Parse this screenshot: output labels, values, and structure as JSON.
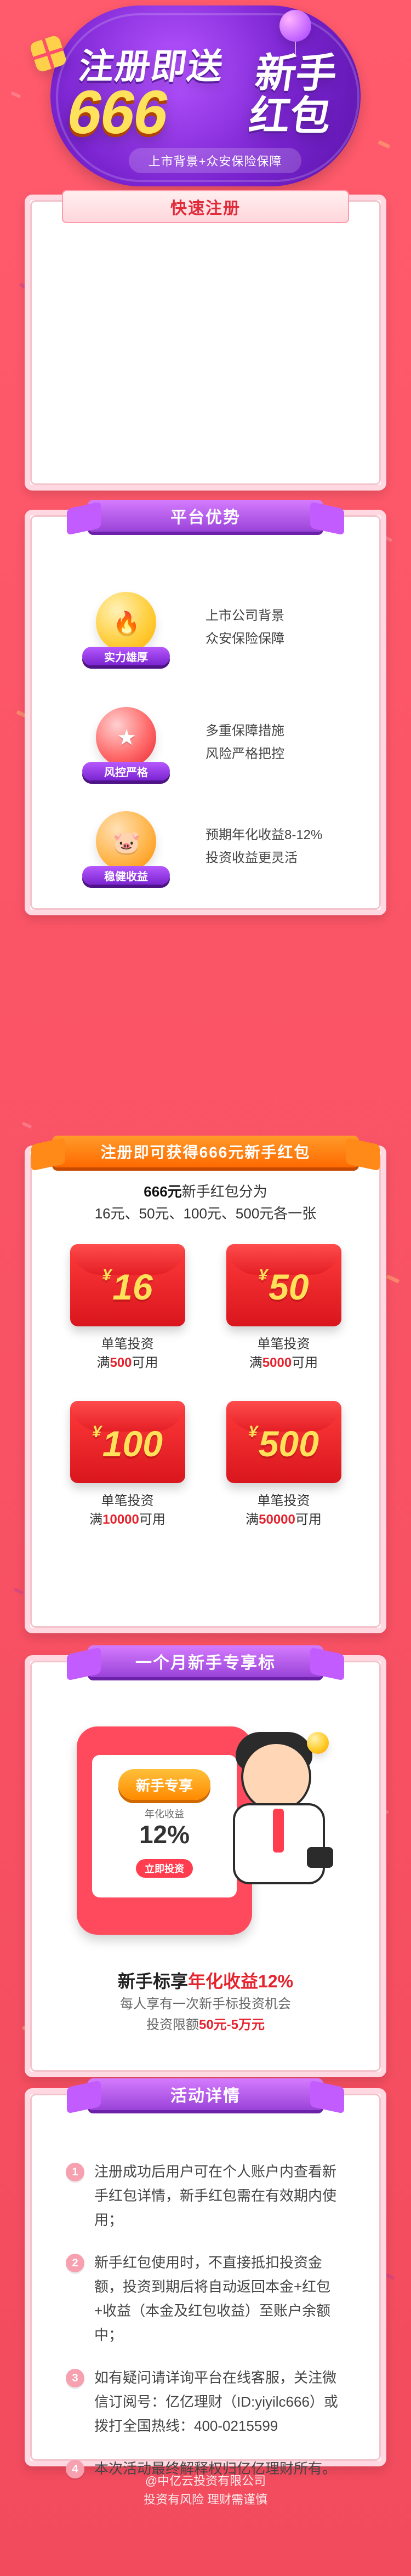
{
  "hero": {
    "title_line1": "注册即送",
    "title_big": "666",
    "title_right_line1": "新手",
    "title_right_line2": "红包",
    "subtitle": "上市背景+众安保险保障"
  },
  "register": {
    "title": "快速注册"
  },
  "advantages": {
    "title": "平台优势",
    "items": [
      {
        "tag": "实力雄厚",
        "icon": "flame-icon",
        "lines": [
          "上市公司背景",
          "众安保险保障"
        ]
      },
      {
        "tag": "风控严格",
        "icon": "shield-star-icon",
        "lines": [
          "多重保障措施",
          "风险严格把控"
        ]
      },
      {
        "tag": "稳健收益",
        "icon": "piggy-bank-icon",
        "lines": [
          "预期年化收益8-12%",
          "投资收益更灵活"
        ]
      }
    ]
  },
  "gift": {
    "title": "注册即可获得666元新手红包",
    "intro_line1_bold": "666元",
    "intro_line1_rest": "新手红包分为",
    "intro_line2": "16元、50元、100元、500元各一张",
    "packets": [
      {
        "amount": "16",
        "cap1": "单笔投资",
        "cap2_prefix": "满",
        "cap2_hi": "500",
        "cap2_suffix": "可用"
      },
      {
        "amount": "50",
        "cap1": "单笔投资",
        "cap2_prefix": "满",
        "cap2_hi": "5000",
        "cap2_suffix": "可用"
      },
      {
        "amount": "100",
        "cap1": "单笔投资",
        "cap2_prefix": "满",
        "cap2_hi": "10000",
        "cap2_suffix": "可用"
      },
      {
        "amount": "500",
        "cap1": "单笔投资",
        "cap2_prefix": "满",
        "cap2_hi": "50000",
        "cap2_suffix": "可用"
      }
    ],
    "yen": "¥"
  },
  "newbie": {
    "title": "一个月新手专享标",
    "screen_badge": "新手专享",
    "screen_small": "年化收益",
    "screen_rate": "12%",
    "screen_button": "立即投资",
    "headline_prefix": "新手标享",
    "headline_hi": "年化收益12%",
    "desc1": "每人享有一次新手标投资机会",
    "desc2_prefix": "投资限额",
    "desc2_hi": "50元-5万元"
  },
  "details": {
    "title": "活动详情",
    "items": [
      {
        "n": "1",
        "text": "注册成功后用户可在个人账户内查看新手红包详情，新手红包需在有效期内使用；"
      },
      {
        "n": "2",
        "text": "新手红包使用时，不直接抵扣投资金额，投资到期后将自动返回本金+红包+收益（本金及红包收益）至账户余额中；"
      },
      {
        "n": "3",
        "text": "如有疑问请详询平台在线客服，关注微信订阅号：亿亿理财（ID:yiyilc666）或拨打全国热线：400-0215599"
      },
      {
        "n": "4",
        "text": "本次活动最终解释权归亿亿理财所有。"
      }
    ]
  },
  "footer": {
    "line1": "@中亿云投资有限公司",
    "line2": "投资有风险 理财需谨慎"
  }
}
